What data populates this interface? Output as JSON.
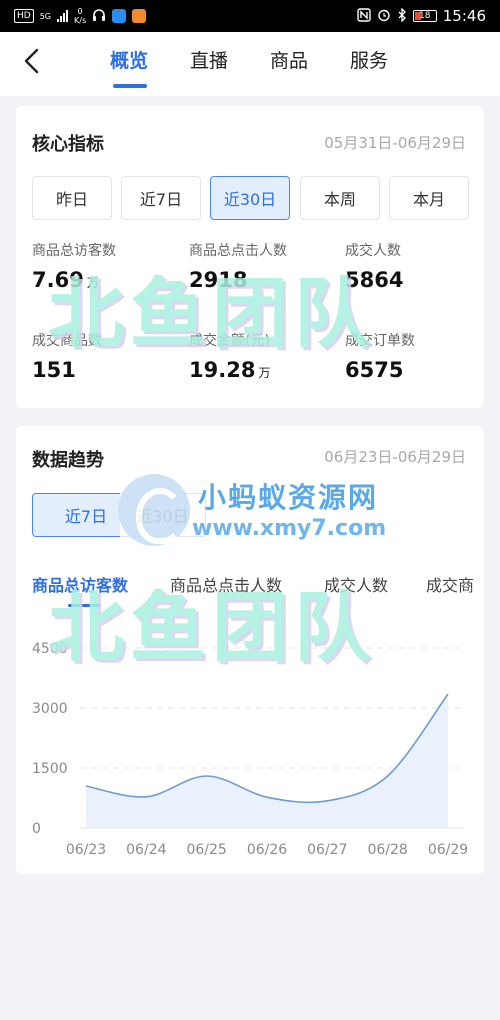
{
  "status_bar": {
    "network_badge": "HD",
    "signal_label": "5G",
    "speed_value": "0",
    "speed_unit": "K/s",
    "battery": "18",
    "time": "15:46"
  },
  "nav": {
    "tabs": [
      {
        "label": "概览",
        "active": true
      },
      {
        "label": "直播",
        "active": false
      },
      {
        "label": "商品",
        "active": false
      },
      {
        "label": "服务",
        "active": false
      }
    ]
  },
  "core_metrics": {
    "title": "核心指标",
    "date_range": "05月31日-06月29日",
    "periods": [
      {
        "label": "昨日",
        "active": false
      },
      {
        "label": "近7日",
        "active": false
      },
      {
        "label": "近30日",
        "active": true
      },
      {
        "label": "本周",
        "active": false
      },
      {
        "label": "本月",
        "active": false
      }
    ],
    "metrics": [
      {
        "label": "商品总访客数",
        "value": "7.69",
        "unit": "万"
      },
      {
        "label": "商品总点击人数",
        "value": "2918",
        "unit": ""
      },
      {
        "label": "成交人数",
        "value": "5864",
        "unit": ""
      },
      {
        "label": "成交商品数",
        "value": "151",
        "unit": ""
      },
      {
        "label": "成交金额(元)",
        "value": "19.28",
        "unit": "万"
      },
      {
        "label": "成交订单数",
        "value": "6575",
        "unit": ""
      }
    ]
  },
  "trend": {
    "title": "数据趋势",
    "date_range": "06月23日-06月29日",
    "periods": [
      {
        "label": "近7日",
        "active": true
      },
      {
        "label": "近30日",
        "active": false
      }
    ],
    "metric_tabs": [
      {
        "label": "商品总访客数",
        "active": true
      },
      {
        "label": "商品总点击人数",
        "active": false
      },
      {
        "label": "成交人数",
        "active": false
      },
      {
        "label": "成交商",
        "active": false
      }
    ]
  },
  "chart_data": {
    "type": "line",
    "categories": [
      "06/23",
      "06/24",
      "06/25",
      "06/26",
      "06/27",
      "06/28",
      "06/29"
    ],
    "values": [
      1050,
      780,
      1300,
      770,
      680,
      1300,
      3350
    ],
    "y_ticks": [
      "0",
      "1500",
      "3000",
      "4500"
    ],
    "ylim": [
      0,
      4500
    ],
    "grid": true,
    "line_color": "#6e9bd6",
    "fill_color": "#e8f0fb"
  },
  "watermarks": {
    "team_text": "北鱼团队",
    "site_name": "小蚂蚁资源网",
    "site_url": "www.xmy7.com"
  },
  "colors": {
    "accent": "#2f6fe0",
    "background": "#f2f3f7"
  }
}
